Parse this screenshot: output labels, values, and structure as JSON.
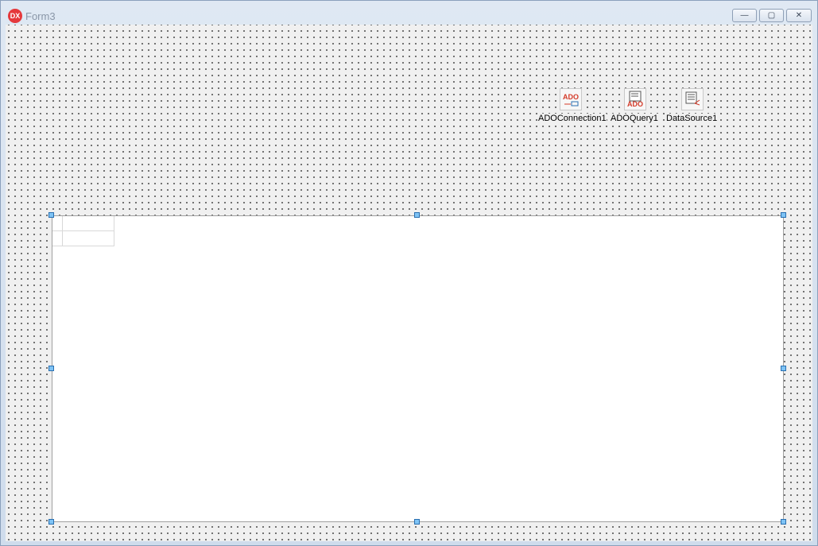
{
  "window": {
    "title": "Form3",
    "app_icon": "DX",
    "buttons": {
      "minimize": "—",
      "maximize": "▢",
      "close": "✕"
    }
  },
  "components": [
    {
      "label": "ADOConnection1",
      "icon": "ado-connection-icon"
    },
    {
      "label": "ADOQuery1",
      "icon": "ado-query-icon"
    },
    {
      "label": "DataSource1",
      "icon": "datasource-icon"
    }
  ],
  "icon_texts": {
    "ado": "ADO"
  },
  "colors": {
    "accent": "#e5383b",
    "handle": "#7ec3f5",
    "ado": "#d43b2a"
  }
}
